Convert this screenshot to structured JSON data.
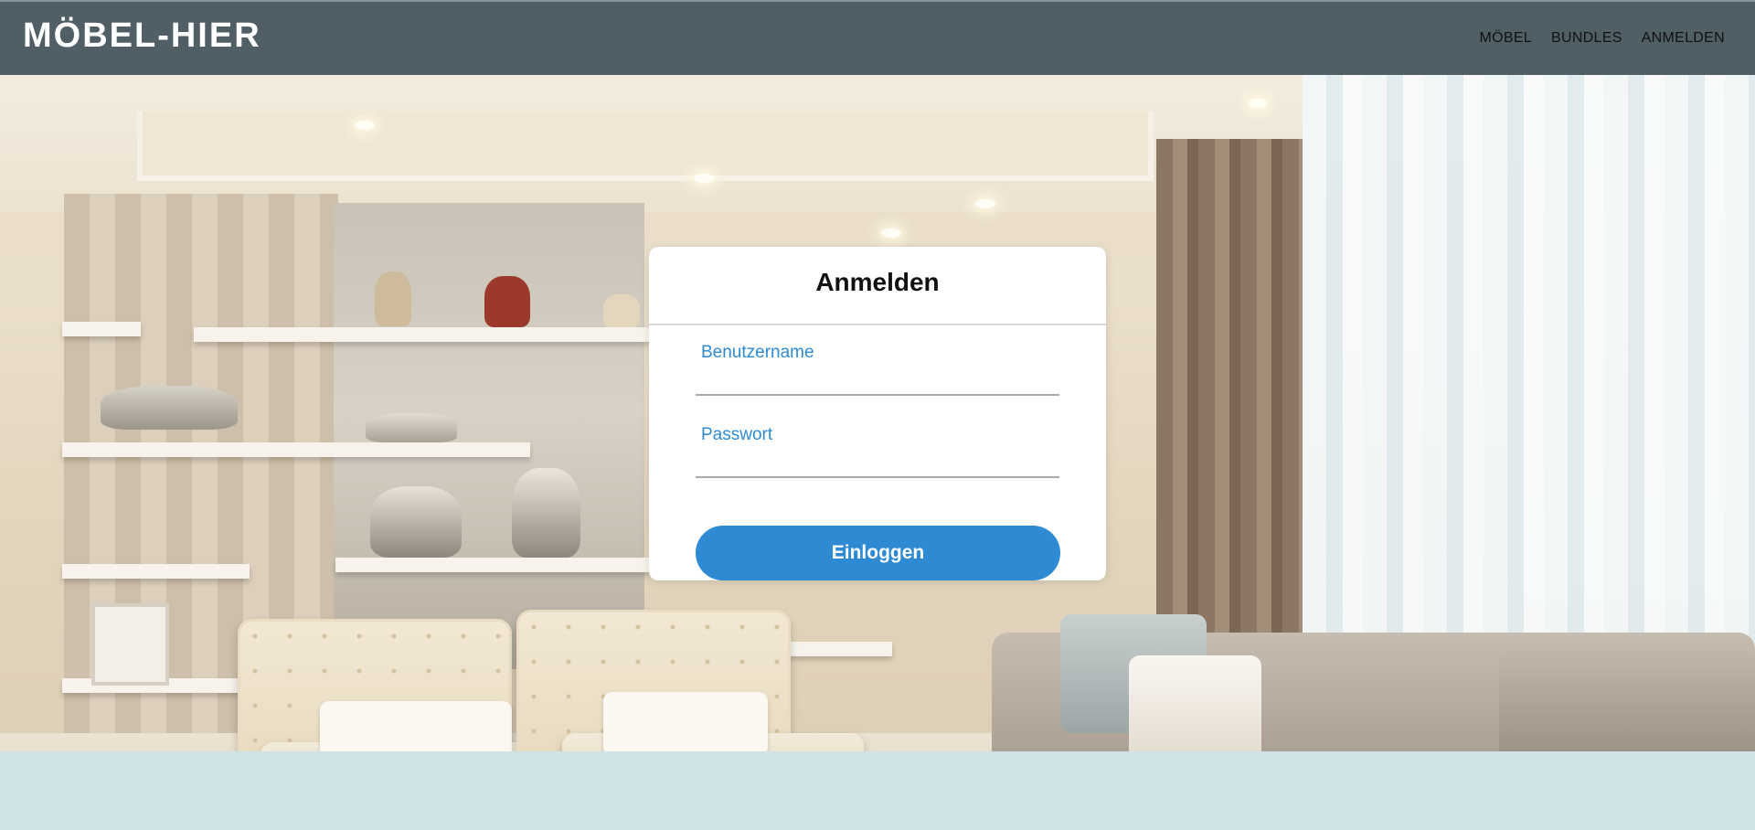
{
  "brand": {
    "logo_text": "MÖBEL-HIER"
  },
  "nav": {
    "items": [
      {
        "label": "MÖBEL"
      },
      {
        "label": "BUNDLES"
      },
      {
        "label": "ANMELDEN"
      }
    ]
  },
  "login": {
    "title": "Anmelden",
    "username_label": "Benutzername",
    "username_value": "",
    "password_label": "Passwort",
    "password_value": "",
    "submit_label": "Einloggen"
  },
  "colors": {
    "header_bg": "#505e66",
    "accent": "#2d8ad3",
    "card_bg": "#ffffff"
  }
}
